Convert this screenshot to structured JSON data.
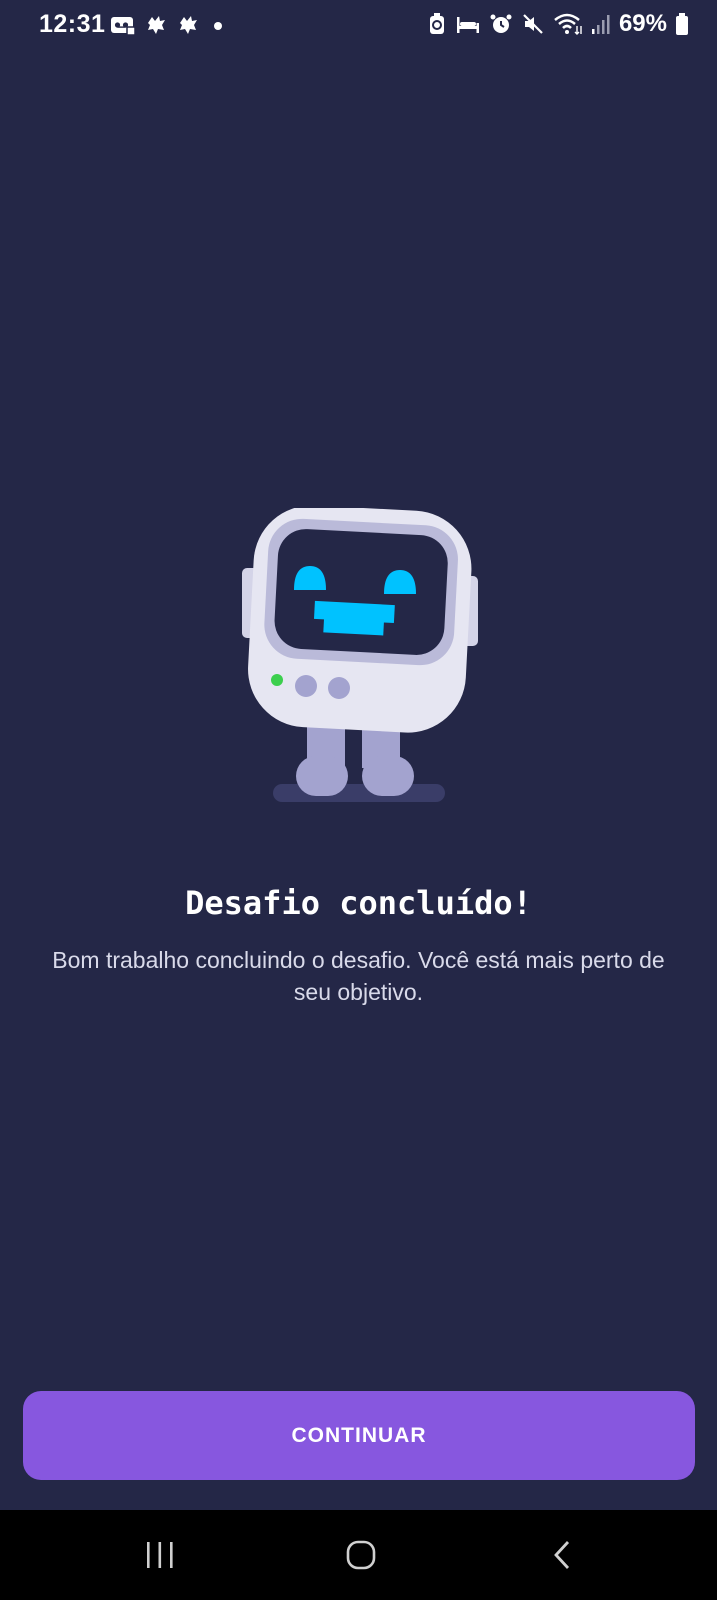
{
  "status_bar": {
    "time": "12:31",
    "battery_percent": "69%",
    "left_icons": [
      "voicemail-icon",
      "notification-bird-icon",
      "notification-bird-icon",
      "dot-icon"
    ],
    "right_icons": [
      "battery-saver-icon",
      "sleep-icon",
      "alarm-icon",
      "mute-icon",
      "wifi-icon",
      "signal-icon",
      "battery-icon"
    ]
  },
  "mascot": {
    "icon": "robot-mascot-icon",
    "colors": {
      "body": "#e6e6f2",
      "screen": "#242747",
      "face": "#00c2ff",
      "legs": "#a3a3cf",
      "led": "#3ccf4e"
    }
  },
  "main": {
    "title": "Desafio concluído!",
    "subtitle": "Bom trabalho concluindo o desafio. Você está mais perto de seu objetivo."
  },
  "actions": {
    "continue_label": "CONTINUAR"
  },
  "nav_bar": {
    "items": [
      "recent-apps-icon",
      "home-icon",
      "back-icon"
    ]
  },
  "colors": {
    "background": "#242747",
    "accent": "#8757df",
    "nav_background": "#000000"
  }
}
